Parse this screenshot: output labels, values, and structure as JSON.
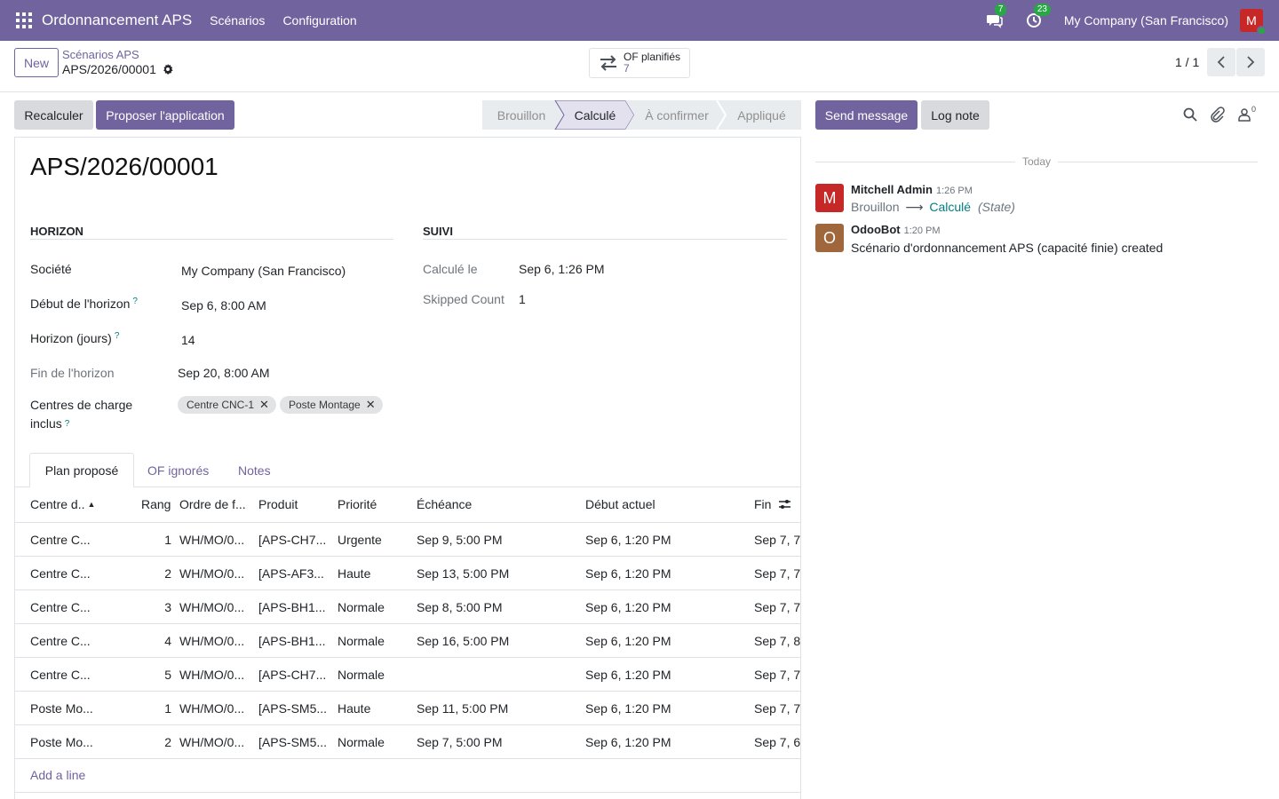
{
  "navbar": {
    "app_title": "Ordonnancement APS",
    "menus": [
      "Scénarios",
      "Configuration"
    ],
    "messages_badge": "7",
    "activities_badge": "23",
    "company": "My Company (San Francisco)",
    "avatar_letter": "M",
    "bg_color": "#71639e"
  },
  "control": {
    "new_label": "New",
    "breadcrumb": "Scénarios APS",
    "record": "APS/2026/00001",
    "smart_button": {
      "label": "OF planifiés",
      "value": "7"
    },
    "pager": "1 / 1"
  },
  "actions": {
    "recalc": "Recalculer",
    "propose": "Proposer l'application"
  },
  "statusbar": {
    "stages": [
      "Brouillon",
      "Calculé",
      "À confirmer",
      "Appliqué"
    ],
    "current": "Calculé"
  },
  "form": {
    "title": "APS/2026/00001",
    "horizon_group": "HORIZON",
    "suivi_group": "SUIVI",
    "fields": {
      "societe_label": "Société",
      "societe_value": "My Company (San Francisco)",
      "debut_label": "Début de l'horizon",
      "debut_value": "Sep 6, 8:00 AM",
      "horizon_label": "Horizon (jours)",
      "horizon_value": "14",
      "fin_label": "Fin de l'horizon",
      "fin_value": "Sep 20, 8:00 AM",
      "centres_label": "Centres de charge inclus",
      "centres_tags": [
        "Centre CNC-1",
        "Poste Montage"
      ],
      "calcule_label": "Calculé le",
      "calcule_value": "Sep 6, 1:26 PM",
      "skipped_label": "Skipped Count",
      "skipped_value": "1",
      "help_mark": "?"
    },
    "tabs": [
      "Plan proposé",
      "OF ignorés",
      "Notes"
    ],
    "table": {
      "columns": [
        "Centre d..",
        "Rang",
        "Ordre de f...",
        "Produit",
        "Priorité",
        "Échéance",
        "Début actuel",
        "Fin"
      ],
      "rows": [
        [
          "Centre C...",
          "1",
          "WH/MO/0...",
          "[APS-CH7...",
          "Urgente",
          "Sep 9, 5:00 PM",
          "Sep 6, 1:20 PM",
          "Sep 7, 7"
        ],
        [
          "Centre C...",
          "2",
          "WH/MO/0...",
          "[APS-AF3...",
          "Haute",
          "Sep 13, 5:00 PM",
          "Sep 6, 1:20 PM",
          "Sep 7, 7"
        ],
        [
          "Centre C...",
          "3",
          "WH/MO/0...",
          "[APS-BH1...",
          "Normale",
          "Sep 8, 5:00 PM",
          "Sep 6, 1:20 PM",
          "Sep 7, 7"
        ],
        [
          "Centre C...",
          "4",
          "WH/MO/0...",
          "[APS-BH1...",
          "Normale",
          "Sep 16, 5:00 PM",
          "Sep 6, 1:20 PM",
          "Sep 7, 8"
        ],
        [
          "Centre C...",
          "5",
          "WH/MO/0...",
          "[APS-CH7...",
          "Normale",
          "",
          "Sep 6, 1:20 PM",
          "Sep 7, 7"
        ],
        [
          "Poste Mo...",
          "1",
          "WH/MO/0...",
          "[APS-SM5...",
          "Haute",
          "Sep 11, 5:00 PM",
          "Sep 6, 1:20 PM",
          "Sep 7, 7"
        ],
        [
          "Poste Mo...",
          "2",
          "WH/MO/0...",
          "[APS-SM5...",
          "Normale",
          "Sep 7, 5:00 PM",
          "Sep 6, 1:20 PM",
          "Sep 7, 6"
        ]
      ],
      "add_line": "Add a line"
    }
  },
  "chatter": {
    "send_message": "Send message",
    "log_note": "Log note",
    "followers_count": "0",
    "today": "Today",
    "messages": [
      {
        "author": "Mitchell Admin",
        "time": "1:26 PM",
        "avatar": "M",
        "avatar_color": "#c62828",
        "from": "Brouillon",
        "to": "Calculé",
        "field": "(State)"
      },
      {
        "author": "OdooBot",
        "time": "1:20 PM",
        "avatar": "O",
        "avatar_color": "#a0673d",
        "body": "Scénario d'ordonnancement APS (capacité finie) created"
      }
    ]
  }
}
